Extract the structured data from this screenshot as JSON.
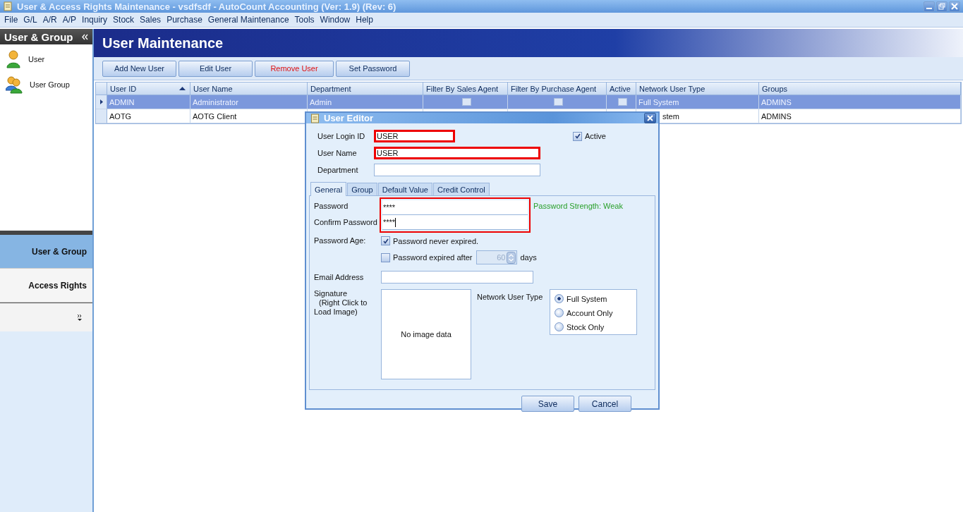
{
  "window": {
    "title": "User & Access Rights Maintenance - vsdfsdf - AutoCount Accounting (Ver: 1.9) (Rev: 6)"
  },
  "menu": [
    "File",
    "G/L",
    "A/R",
    "A/P",
    "Inquiry",
    "Stock",
    "Sales",
    "Purchase",
    "General Maintenance",
    "Tools",
    "Window",
    "Help"
  ],
  "sidebar": {
    "title": "User & Group",
    "items": [
      {
        "label": "User",
        "kind": "user"
      },
      {
        "label": "User Group",
        "kind": "group"
      }
    ],
    "nav": [
      {
        "label": "User & Group",
        "selected": true
      },
      {
        "label": "Access Rights",
        "selected": false
      }
    ]
  },
  "page": {
    "title": "User Maintenance"
  },
  "toolbar": [
    {
      "label": "Add New User",
      "kind": "normal"
    },
    {
      "label": "Edit User",
      "kind": "normal"
    },
    {
      "label": "Remove User",
      "kind": "danger"
    },
    {
      "label": "Set Password",
      "kind": "normal"
    }
  ],
  "table": {
    "columns": [
      {
        "label": "User ID",
        "sorted": true
      },
      {
        "label": "User Name",
        "sorted": false
      },
      {
        "label": "Department",
        "sorted": false
      },
      {
        "label": "Filter By Sales Agent",
        "sorted": false
      },
      {
        "label": "Filter By Purchase Agent",
        "sorted": false
      },
      {
        "label": "Active",
        "sorted": false
      },
      {
        "label": "Network User Type",
        "sorted": false
      },
      {
        "label": "Groups",
        "sorted": false
      }
    ],
    "rows": [
      {
        "selected": true,
        "cells": [
          {
            "kind": "text",
            "text": "ADMIN"
          },
          {
            "kind": "text",
            "text": "Administrator"
          },
          {
            "kind": "text",
            "text": "Admin"
          },
          {
            "kind": "check",
            "checked": false
          },
          {
            "kind": "check",
            "checked": false
          },
          {
            "kind": "check",
            "checked": false
          },
          {
            "kind": "text",
            "text": "Full System"
          },
          {
            "kind": "text",
            "text": "ADMINS"
          }
        ]
      },
      {
        "selected": false,
        "cells": [
          {
            "kind": "text",
            "text": "AOTG"
          },
          {
            "kind": "text",
            "text": "AOTG Client"
          },
          {
            "kind": "covered"
          },
          {
            "kind": "covered"
          },
          {
            "kind": "covered"
          },
          {
            "kind": "covered"
          },
          {
            "kind": "partly_covered",
            "text": "stem"
          },
          {
            "kind": "text",
            "text": "ADMINS"
          }
        ]
      }
    ]
  },
  "dialog": {
    "title": "User Editor",
    "login_id": {
      "label": "User Login ID",
      "value": "USER",
      "highlighted": true
    },
    "user_name": {
      "label": "User Name",
      "value": "USER",
      "highlighted": true
    },
    "department": {
      "label": "Department",
      "highlighted": false
    },
    "active": {
      "label": "Active",
      "checked": true
    },
    "tabs": [
      {
        "label": "General",
        "selected": true
      },
      {
        "label": "Group",
        "selected": false
      },
      {
        "label": "Default Value",
        "selected": false
      },
      {
        "label": "Credit Control",
        "selected": false
      }
    ],
    "passwords_highlighted": true,
    "password": {
      "label": "Password",
      "value": "****"
    },
    "confirm_password": {
      "label": "Confirm Password",
      "value": "****"
    },
    "strength": "Password Strength: Weak",
    "password_age": {
      "label": "Password Age:",
      "never": {
        "label": "Password never expired.",
        "checked": true
      },
      "after": {
        "label": "Password expired after",
        "checked": false
      },
      "days_value": "60",
      "days_disabled": true,
      "days_unit": "days"
    },
    "email": {
      "label": "Email Address"
    },
    "signature": {
      "label_lines": [
        "Signature",
        "(Right Click to",
        "Load Image)"
      ],
      "empty_text": "No image data"
    },
    "network_user_type": {
      "label": "Network User Type",
      "options": [
        {
          "label": "Full System",
          "selected": true
        },
        {
          "label": "Account Only",
          "selected": false
        },
        {
          "label": "Stock Only",
          "selected": false
        }
      ]
    },
    "buttons": [
      "Save",
      "Cancel"
    ]
  }
}
